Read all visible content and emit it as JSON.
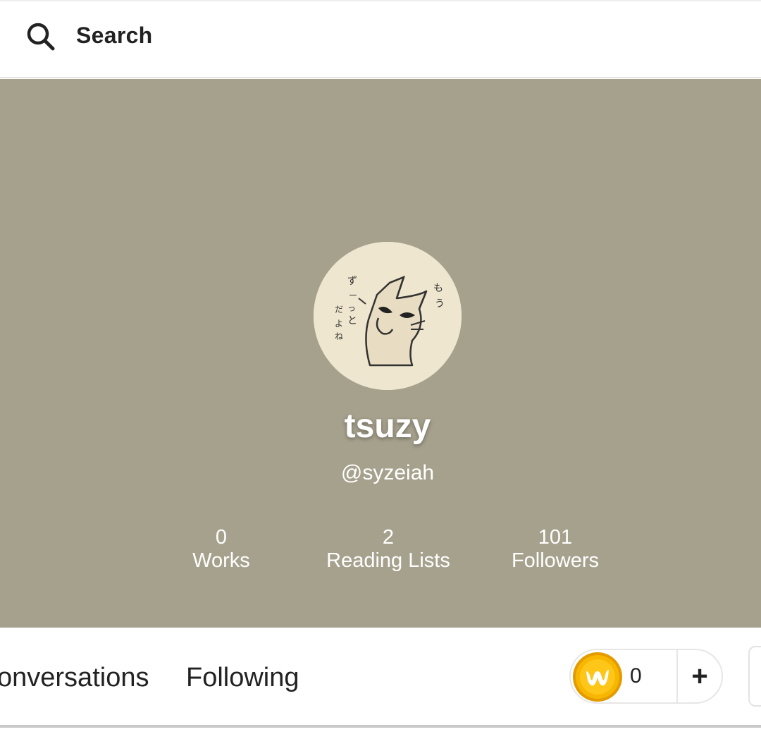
{
  "search": {
    "label": "Search"
  },
  "profile": {
    "display_name": "tsuzy",
    "username": "@syzeiah",
    "stats": [
      {
        "value": "0",
        "label": "Works"
      },
      {
        "value": "2",
        "label": "Reading Lists"
      },
      {
        "value": "101",
        "label": "Followers"
      }
    ],
    "avatar_icon": "cat-illustration"
  },
  "tabs": [
    {
      "label": "onversations"
    },
    {
      "label": "Following"
    }
  ],
  "coins": {
    "count": "0",
    "add_label": "+",
    "icon": "wattpad-coin-icon"
  },
  "colors": {
    "banner": "#a6a18d",
    "avatar_bg": "#efe6cf",
    "coin": "#f7b600"
  }
}
